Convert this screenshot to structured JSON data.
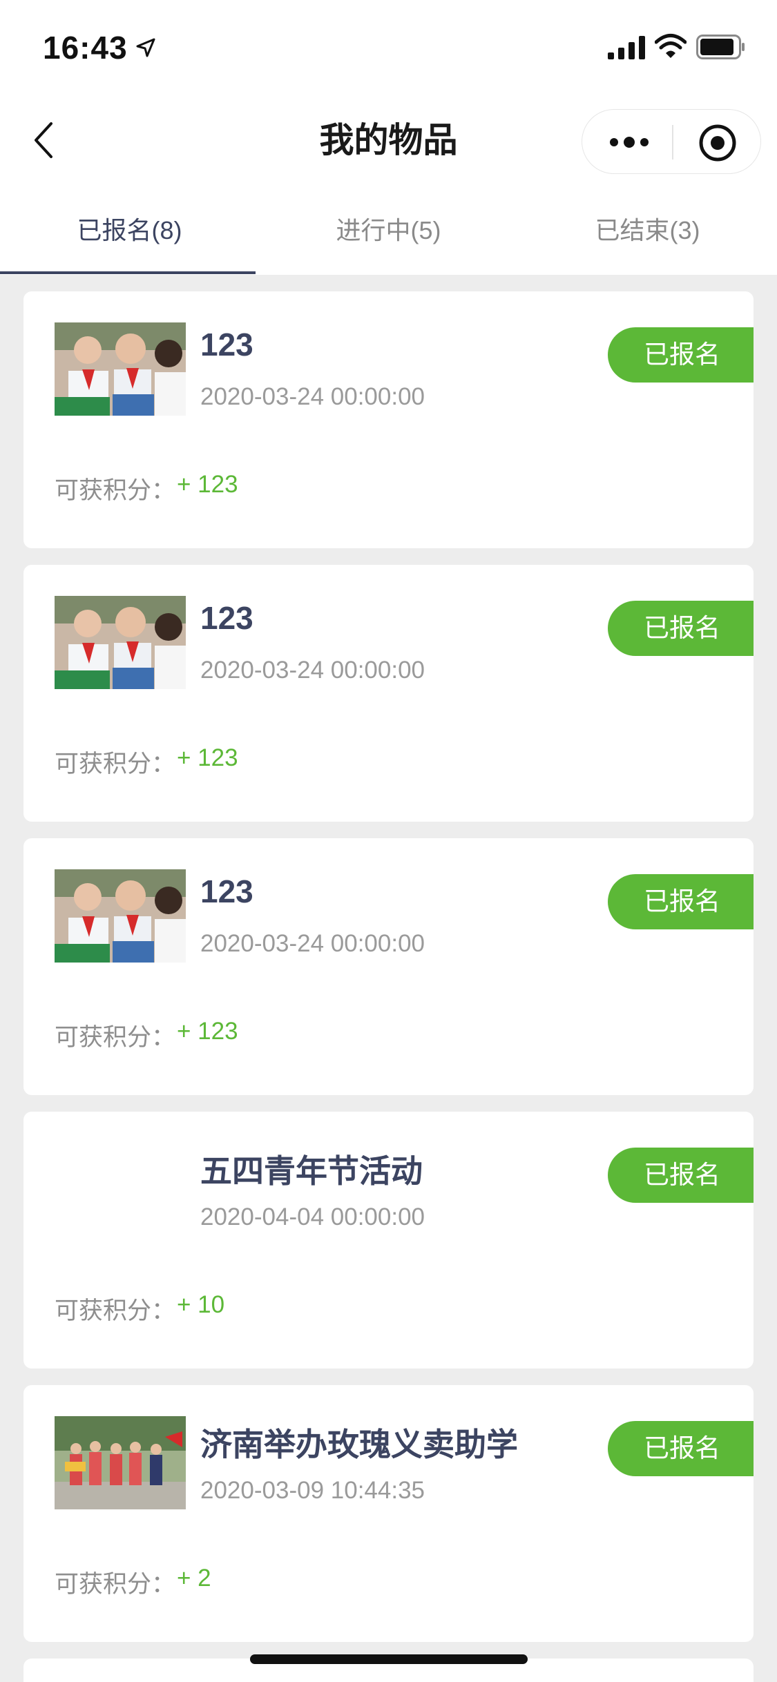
{
  "status_bar": {
    "time": "16:43",
    "icons": [
      "location-arrow-icon",
      "signal-icon",
      "wifi-icon",
      "battery-icon"
    ]
  },
  "nav": {
    "title": "我的物品",
    "back_icon": "chevron-left-icon",
    "capsule_icons": [
      "more-icon",
      "target-icon"
    ]
  },
  "tabs": [
    {
      "label": "已报名(8)",
      "active": true
    },
    {
      "label": "进行中(5)",
      "active": false
    },
    {
      "label": "已结束(3)",
      "active": false
    }
  ],
  "points_label": "可获积分：",
  "items": [
    {
      "title": "123",
      "date": "2020-03-24 00:00:00",
      "status": "已报名",
      "points": "+ 123",
      "image": "students-photo"
    },
    {
      "title": "123",
      "date": "2020-03-24 00:00:00",
      "status": "已报名",
      "points": "+ 123",
      "image": "students-photo"
    },
    {
      "title": "123",
      "date": "2020-03-24 00:00:00",
      "status": "已报名",
      "points": "+ 123",
      "image": "students-photo"
    },
    {
      "title": "五四青年节活动",
      "date": "2020-04-04 00:00:00",
      "status": "已报名",
      "points": "+ 10",
      "image": ""
    },
    {
      "title": "济南举办玫瑰义卖助学",
      "date": "2020-03-09 10:44:35",
      "status": "已报名",
      "points": "+ 2",
      "image": "volunteers-photo"
    }
  ],
  "colors": {
    "accent_green": "#5cb837",
    "title_navy": "#3c4461",
    "background": "#ededed"
  }
}
